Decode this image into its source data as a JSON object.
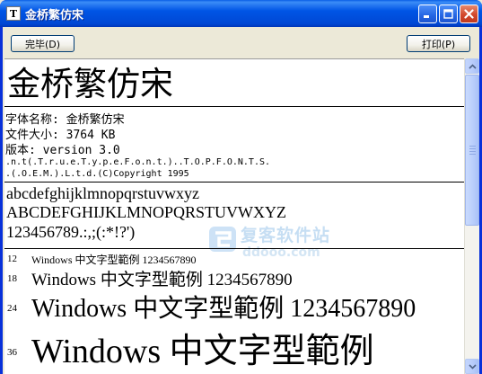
{
  "window": {
    "title": "金桥繁仿宋",
    "icon": "font-file-icon",
    "icon_glyph": "T",
    "controls": [
      "minimize-icon",
      "maximize-icon",
      "close-icon"
    ]
  },
  "toolbar": {
    "done_label": "完毕(D)",
    "print_label": "打印(P)"
  },
  "preview": {
    "font_name_large": "金桥繁仿宋",
    "info": {
      "name_line": "字体名称: 金桥繁仿宋",
      "size_line": "文件大小: 3764 KB",
      "version_line": "版本: version 3.0",
      "trademark_line": ".n.t(.T.r.u.e.T.y.p.e.F.o.n.t.)..T.O.P.F.O.N.T.S.",
      "copyright_line": ".(.O.E.M.).L.t.d.(C)Copyright 1995"
    },
    "charset": {
      "lowercase": "abcdefghijklmnopqrstuvwxyz",
      "uppercase": "ABCDEFGHIJKLMNOPQRSTUVWXYZ",
      "digits": "123456789.:,;(:*!?')"
    },
    "samples": [
      {
        "size": "12",
        "text": "Windows 中文字型範例 1234567890"
      },
      {
        "size": "18",
        "text": "Windows 中文字型範例 1234567890"
      },
      {
        "size": "24",
        "text": "Windows 中文字型範例 1234567890"
      },
      {
        "size": "36",
        "text": "Windows 中文字型範例"
      }
    ],
    "watermark": {
      "text_cn": "复客软件站",
      "url": "ddooo.com"
    }
  },
  "colors": {
    "titlebar": "#0055e5",
    "window_frame": "#0831d9",
    "close_button": "#d2482c",
    "dialog_bg": "#ece9d8",
    "scrollbar": "#b9cdfb"
  }
}
